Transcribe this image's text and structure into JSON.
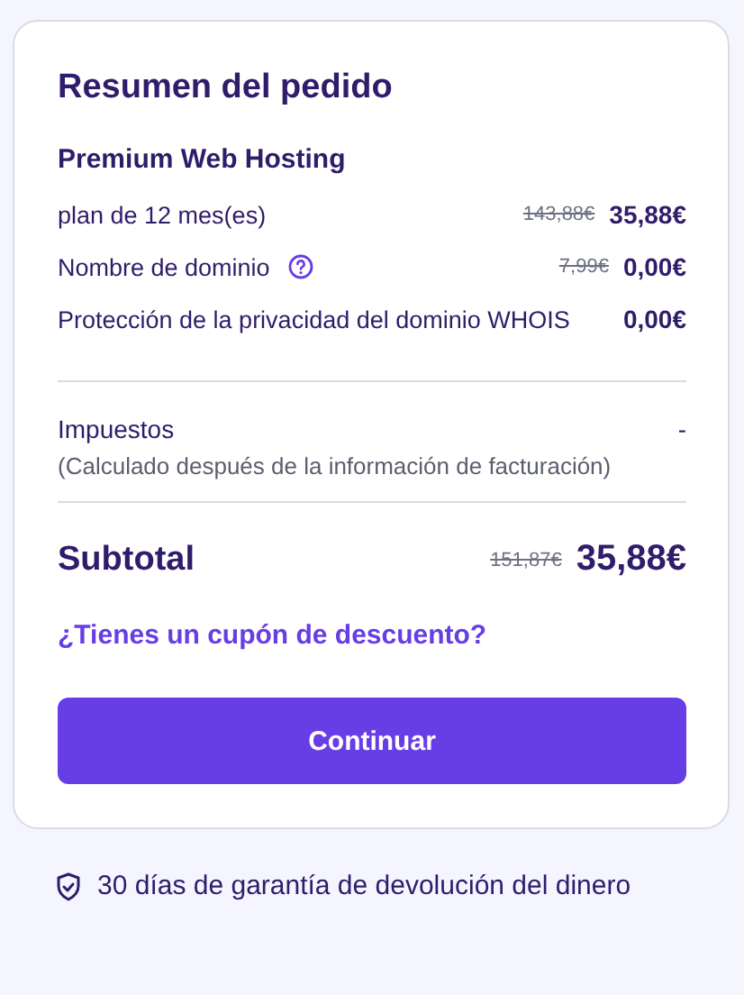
{
  "summary": {
    "title": "Resumen del pedido",
    "product": "Premium Web Hosting",
    "items": [
      {
        "label": "plan de 12 mes(es)",
        "help": false,
        "old_price": "143,88€",
        "price": "35,88€"
      },
      {
        "label": "Nombre de dominio",
        "help": true,
        "old_price": "7,99€",
        "price": "0,00€"
      },
      {
        "label": "Protección de la privacidad del dominio WHOIS",
        "help": false,
        "price": "0,00€"
      }
    ],
    "taxes": {
      "label": "Impuestos",
      "value": "-",
      "note": "(Calculado después de la información de facturación)"
    },
    "subtotal": {
      "label": "Subtotal",
      "old_price": "151,87€",
      "price": "35,88€"
    },
    "coupon_link": "¿Tienes un cupón de descuento?",
    "continue_button": "Continuar"
  },
  "guarantee": "30 días de garantía de devolución del dinero"
}
